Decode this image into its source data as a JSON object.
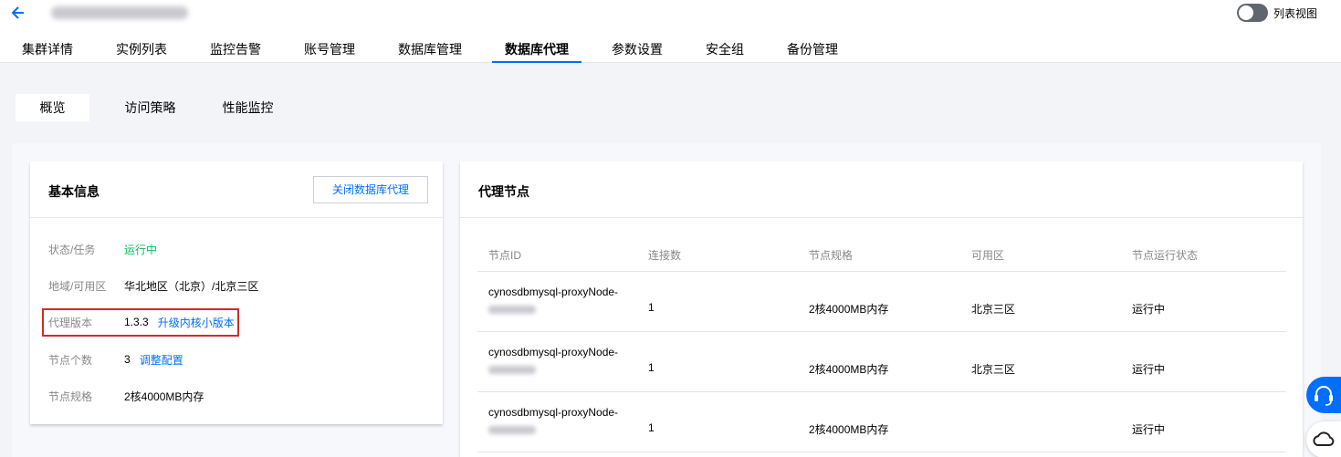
{
  "header": {
    "back_icon": "arrow-left-icon",
    "toggle_label": "列表视图",
    "tabs": [
      {
        "label": "集群详情"
      },
      {
        "label": "实例列表"
      },
      {
        "label": "监控告警"
      },
      {
        "label": "账号管理"
      },
      {
        "label": "数据库管理"
      },
      {
        "label": "数据库代理",
        "active": true
      },
      {
        "label": "参数设置"
      },
      {
        "label": "安全组"
      },
      {
        "label": "备份管理"
      }
    ]
  },
  "subtabs": [
    {
      "label": "概览",
      "active": true
    },
    {
      "label": "访问策略"
    },
    {
      "label": "性能监控"
    }
  ],
  "basic_info": {
    "title": "基本信息",
    "close_proxy_label": "关闭数据库代理",
    "status_label": "状态/任务",
    "status_value": "运行中",
    "region_label": "地域/可用区",
    "region_value": "华北地区（北京）/北京三区",
    "version_label": "代理版本",
    "version_value": "1.3.3",
    "upgrade_link": "升级内核小版本",
    "node_count_label": "节点个数",
    "node_count_value": "3",
    "adjust_link": "调整配置",
    "node_spec_label": "节点规格",
    "node_spec_value": "2核4000MB内存"
  },
  "proxy_nodes": {
    "title": "代理节点",
    "columns": [
      "节点ID",
      "连接数",
      "节点规格",
      "可用区",
      "节点运行状态"
    ],
    "rows": [
      {
        "id": "cynosdbmysql-proxyNode-",
        "connections": "1",
        "spec": "2核4000MB内存",
        "zone": "北京三区",
        "status": "运行中"
      },
      {
        "id": "cynosdbmysql-proxyNode-",
        "connections": "1",
        "spec": "2核4000MB内存",
        "zone": "北京三区",
        "status": "运行中"
      },
      {
        "id": "cynosdbmysql-proxyNode-",
        "connections": "1",
        "spec": "2核4000MB内存",
        "zone": "",
        "status": "运行中"
      }
    ]
  },
  "colors": {
    "accent": "#006eff",
    "success": "#0abf5b",
    "highlight": "#d22b2b"
  }
}
